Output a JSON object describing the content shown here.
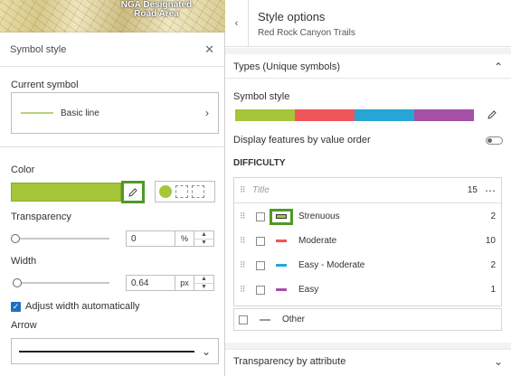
{
  "map": {
    "label": "NGA Designated Road Area"
  },
  "symbol_panel": {
    "title": "Symbol style",
    "current_symbol_label": "Current symbol",
    "current_symbol_name": "Basic line",
    "color_label": "Color",
    "color_value": "#a6c63a",
    "transparency_label": "Transparency",
    "transparency_value": "0",
    "transparency_unit": "%",
    "transparency_level": 0,
    "width_label": "Width",
    "width_value": "0.64",
    "width_unit": "px",
    "adjust_width_label": "Adjust width automatically",
    "adjust_width_checked": true,
    "arrow_label": "Arrow"
  },
  "style_options": {
    "title": "Style options",
    "subtitle": "Red Rock Canyon Trails",
    "types_section_title": "Types (Unique symbols)",
    "symbol_style_label": "Symbol style",
    "ramp_colors": [
      "#a6c63a",
      "#f0555a",
      "#27a6d6",
      "#a64fa6"
    ],
    "display_order_label": "Display features by value order",
    "display_order_on": false,
    "field_heading": "DIFFICULTY",
    "title_placeholder": "Title",
    "total_count": "15",
    "values": [
      {
        "label": "Strenuous",
        "count": "2",
        "color": "#a6c63a",
        "highlighted": true
      },
      {
        "label": "Moderate",
        "count": "10",
        "color": "#f0555a",
        "highlighted": false
      },
      {
        "label": "Easy - Moderate",
        "count": "2",
        "color": "#27a6d6",
        "highlighted": false
      },
      {
        "label": "Easy",
        "count": "1",
        "color": "#a64fa6",
        "highlighted": false
      }
    ],
    "other_label": "Other",
    "other_color": "#9a9a9a",
    "transparency_attr_title": "Transparency by attribute"
  }
}
